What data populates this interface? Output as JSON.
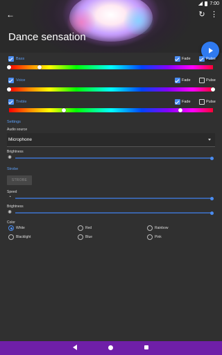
{
  "status": {
    "time": "7:00"
  },
  "header": {
    "title": "Dance sensation",
    "back": "←",
    "refresh": "↻",
    "more": "⋮"
  },
  "channels": [
    {
      "name": "Bass",
      "enabled": true,
      "fade_label": "Fade",
      "fade": true,
      "pulse_label": "Pulse",
      "pulse": true,
      "range_start": 0.0,
      "range_end": 0.15
    },
    {
      "name": "Voice",
      "enabled": true,
      "fade_label": "Fade",
      "fade": true,
      "pulse_label": "Pulse",
      "pulse": false,
      "range_start": 0.0,
      "range_end": 1.0
    },
    {
      "name": "Treble",
      "enabled": true,
      "fade_label": "Fade",
      "fade": true,
      "pulse_label": "Pulse",
      "pulse": false,
      "range_start": 0.27,
      "range_end": 0.84
    }
  ],
  "settings": {
    "section_title": "Settings",
    "audio_source_label": "Audio source",
    "audio_source_value": "Microphone",
    "brightness_label": "Brightness",
    "brightness_level": 1.0
  },
  "strobe": {
    "section_title": "Strobe",
    "button_label": "STROBE",
    "speed_label": "Speed",
    "speed_level": 1.0,
    "brightness_label": "Brightness",
    "brightness_level": 1.0,
    "color_label": "Color",
    "colors": [
      {
        "label": "White",
        "selected": true
      },
      {
        "label": "Red",
        "selected": false
      },
      {
        "label": "Rainbow",
        "selected": false
      },
      {
        "label": "Blacklight",
        "selected": false
      },
      {
        "label": "Blue",
        "selected": false
      },
      {
        "label": "Pink",
        "selected": false
      }
    ]
  },
  "colors": {
    "accent": "#4a8cf0",
    "navbar": "#6f1fa8",
    "background": "#303030"
  }
}
